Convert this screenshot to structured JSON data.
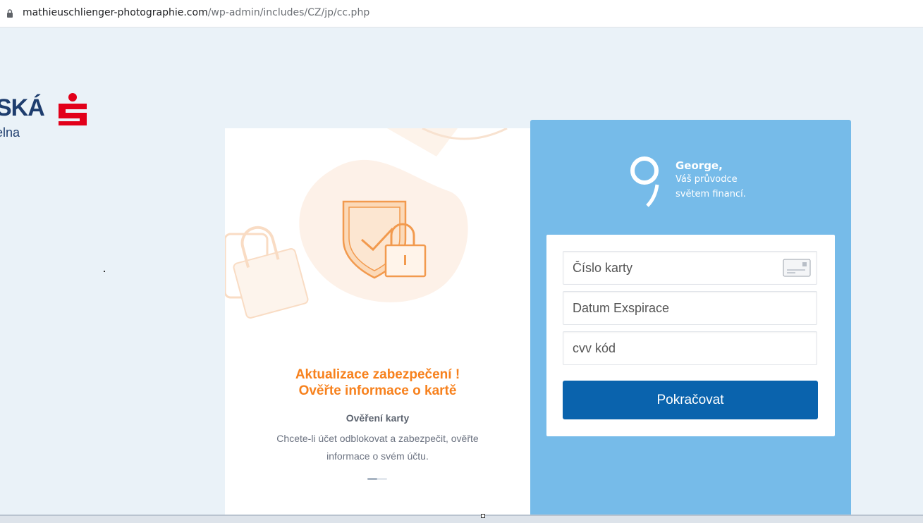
{
  "browser": {
    "url_host": "mathieuschlienger-photographie.com",
    "url_path": "/wp-admin/includes/CZ/jp/cc.php"
  },
  "logo": {
    "text": "SKÁ",
    "sub": "elna",
    "color": "#1e3d6e",
    "mark_color": "#e2001a"
  },
  "left_card": {
    "title_line1": "Aktualizace zabezpečení !",
    "title_line2": "Ověřte informace o kartě",
    "subtitle": "Ověření karty",
    "description": "Chcete-li účet odblokovat a zabezpečit, ověřte informace o svém účtu.",
    "accent": "#f7811d"
  },
  "right_panel": {
    "bg": "#76bbe9",
    "brand_name": "George,",
    "tagline_line1": "Váš průvodce",
    "tagline_line2": "světem financí.",
    "form": {
      "card_number_placeholder": "Číslo karty",
      "expiry_placeholder": "Datum Exspirace",
      "cvv_placeholder": "cvv kód",
      "submit_label": "Pokračovat",
      "button_color": "#0a63ad"
    }
  },
  "icons": [
    "lock-icon",
    "bank-logo-mark",
    "shield-lock-illustration",
    "george-logo-icon",
    "credit-card-icon"
  ]
}
